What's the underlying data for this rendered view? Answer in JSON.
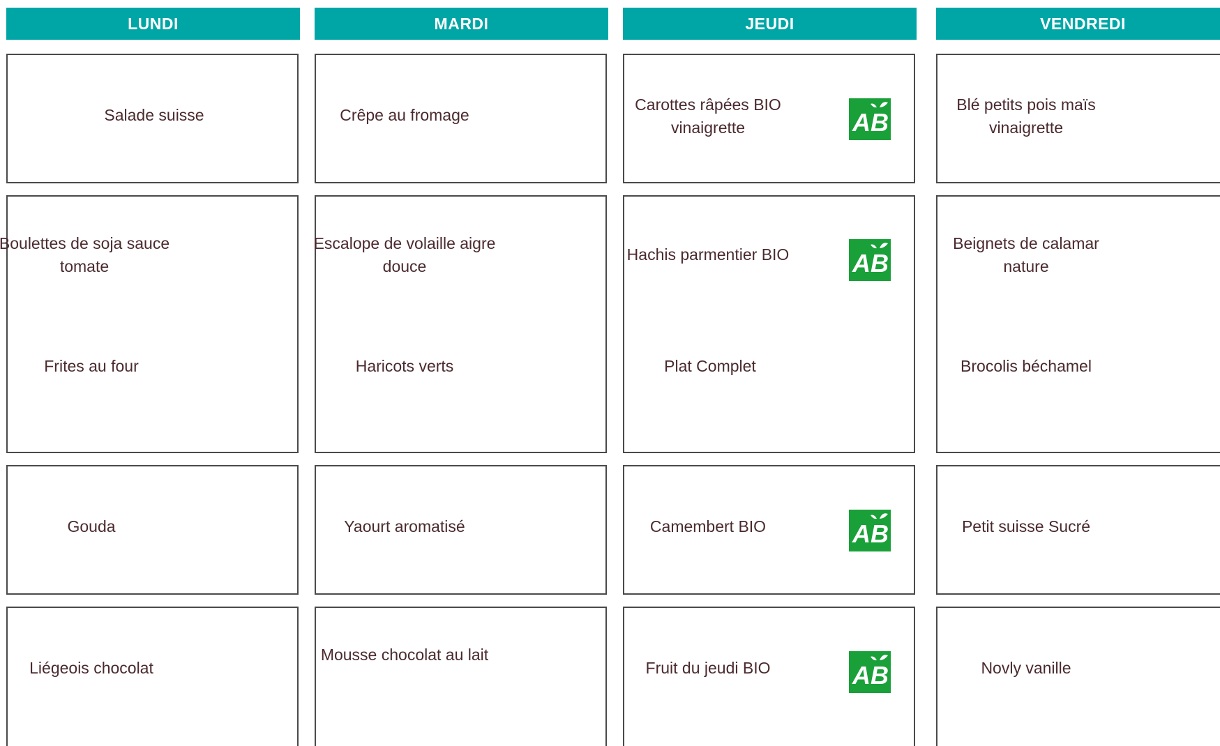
{
  "days": [
    {
      "label": "LUNDI",
      "entree": "Salade suisse",
      "plat": "Boulettes de soja sauce tomate",
      "accompagnement": "Frites au four",
      "laitage": "Gouda",
      "dessert": "Liégeois chocolat"
    },
    {
      "label": "MARDI",
      "entree": "Crêpe au fromage",
      "plat": "Escalope de volaille aigre douce",
      "accompagnement": "Haricots verts",
      "laitage": "Yaourt aromatisé",
      "dessert": "Mousse chocolat au lait"
    },
    {
      "label": "JEUDI",
      "entree": "Carottes râpées BIO vinaigrette",
      "plat": "Hachis parmentier BIO",
      "accompagnement": "Plat Complet",
      "laitage": "Camembert BIO",
      "dessert": "Fruit du jeudi BIO"
    },
    {
      "label": "VENDREDI",
      "entree": "Blé petits pois maïs vinaigrette",
      "plat": "Beignets de calamar nature",
      "accompagnement": "Brocolis béchamel",
      "laitage": "Petit suisse Sucré",
      "dessert": "Novly vanille"
    }
  ],
  "bio_logo": {
    "text": "AB",
    "color": "#1aa039",
    "icon": "organic-ab-logo"
  },
  "colors": {
    "header_bg": "#00a6a6",
    "text": "#4a2a2e",
    "border": "#4a4a4a"
  }
}
